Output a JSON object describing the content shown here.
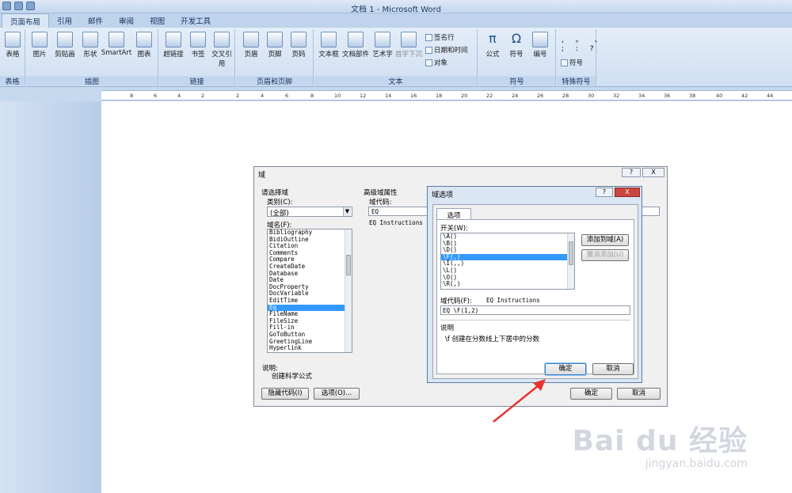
{
  "window": {
    "title": "文档 1 - Microsoft Word"
  },
  "tabs": [
    "页面布局",
    "引用",
    "邮件",
    "审阅",
    "视图",
    "开发工具"
  ],
  "ribbon": {
    "buttons": [
      "表格",
      "图片",
      "剪贴画",
      "形状",
      "SmartArt",
      "图表",
      "超链接",
      "书签",
      "交叉引用",
      "页眉",
      "页脚",
      "页码",
      "文本框",
      "文档部件",
      "艺术字",
      "首字下沉",
      "公式",
      "符号",
      "编号"
    ],
    "small_items": [
      "签名行",
      "日期和时间",
      "对象",
      "符号"
    ],
    "groups": [
      "表格",
      "插图",
      "链接",
      "页眉和页脚",
      "文本",
      "符号",
      "特殊符号"
    ]
  },
  "ruler": {
    "ticks": [
      "8",
      "6",
      "4",
      "2",
      "2",
      "4",
      "6",
      "8",
      "10",
      "12",
      "14",
      "16",
      "18",
      "20",
      "22",
      "24",
      "26",
      "28",
      "30",
      "32",
      "34",
      "36",
      "38",
      "40",
      "42",
      "44"
    ]
  },
  "field_dialog": {
    "title": "域",
    "help": "?",
    "close": "X",
    "choose_field": "请选择域",
    "category_label": "类别(C):",
    "category_value": "(全部)",
    "field_names_label": "域名(F):",
    "field_names": [
      "Bibliography",
      "BidiOutline",
      "Citation",
      "Comments",
      "Compare",
      "CreateDate",
      "Database",
      "Date",
      "DocProperty",
      "DocVariable",
      "EditTime",
      "Eq",
      "FileName",
      "FileSize",
      "Fill-in",
      "GoToButton",
      "GreetingLine",
      "Hyperlink"
    ],
    "selected_field": "Eq",
    "advanced_label": "高级域属性",
    "field_code_label": "域代码:",
    "field_code_value": "EQ",
    "instructions": "EQ Instructions",
    "description_label": "说明:",
    "description": "创建科学公式",
    "hide_codes_button": "隐藏代码(I)",
    "options_button": "选项(O)...",
    "ok": "确定",
    "cancel": "取消"
  },
  "options_dialog": {
    "title": "域选项",
    "help": "?",
    "close": "X",
    "tab": "选项",
    "switches_label": "开关(W):",
    "switches": [
      "\\A()",
      "\\B()",
      "\\D()",
      "\\F(,)",
      "\\I(,,)",
      "\\L()",
      "\\O()",
      "\\R(,)"
    ],
    "selected_switch": "\\F(,)",
    "add_button": "添加到域(A)",
    "undo_button": "撤消添加(U)",
    "field_code_label": "域代码(F):",
    "field_code_hint": "EQ Instructions",
    "field_code_value": "EQ \\F(1,2)",
    "description_label": "说明",
    "description": "\\f 创建在分数线上下居中的分数",
    "ok": "确定",
    "cancel": "取消"
  },
  "watermark": {
    "brand": "Bai du 经验",
    "url": "jingyan.baidu.com"
  },
  "colors": {
    "accent": "#3399ff",
    "annotation_arrow": "#e8332f"
  }
}
